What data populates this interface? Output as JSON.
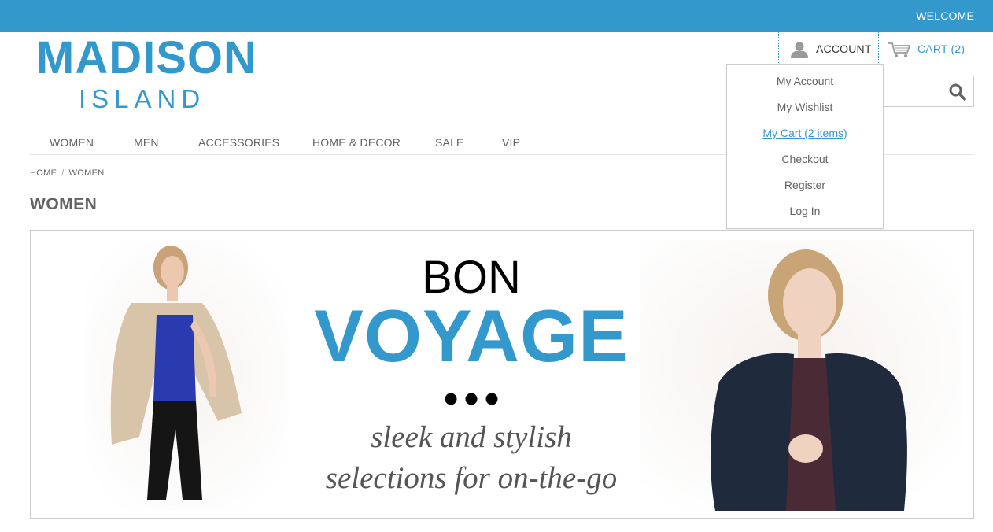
{
  "topbar": {
    "welcome": "WELCOME",
    "bg_color": "#3399cc"
  },
  "logo": {
    "line1": "MADISON",
    "line2": "ISLAND",
    "color": "#3399cc"
  },
  "header": {
    "account_label": "ACCOUNT",
    "account_icon": "user-icon",
    "cart_label": "CART (2)",
    "cart_icon": "shopping-cart-icon",
    "search": {
      "placeholder": "",
      "icon": "search-icon"
    }
  },
  "account_menu": {
    "items": [
      {
        "label": "My Account"
      },
      {
        "label": "My Wishlist"
      },
      {
        "label": "My Cart (2 items)",
        "active": true
      },
      {
        "label": "Checkout"
      },
      {
        "label": "Register"
      },
      {
        "label": "Log In"
      }
    ]
  },
  "nav": {
    "items": [
      {
        "label": "WOMEN"
      },
      {
        "label": "MEN"
      },
      {
        "label": "ACCESSORIES"
      },
      {
        "label": "HOME & DECOR"
      },
      {
        "label": "SALE"
      },
      {
        "label": "VIP"
      }
    ]
  },
  "breadcrumb": {
    "home": "HOME",
    "separator": "/",
    "current": "WOMEN"
  },
  "page": {
    "title": "WOMEN"
  },
  "banner": {
    "line1": "BON",
    "line2": "VOYAGE",
    "tagline1": "sleek and stylish",
    "tagline2": "selections for on-the-go",
    "accent_color": "#3399cc"
  }
}
